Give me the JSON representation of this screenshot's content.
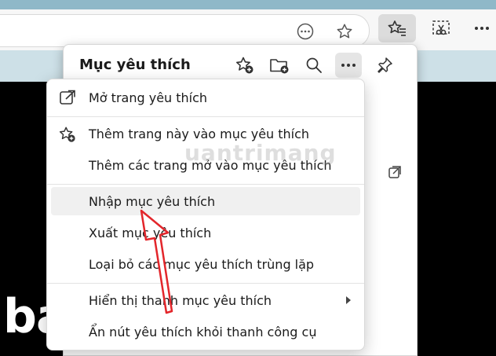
{
  "panel": {
    "title": "Mục yêu thích"
  },
  "menu": {
    "items": [
      {
        "label": "Mở trang yêu thích",
        "icon": "open-external-icon"
      },
      {
        "label": "Thêm trang này vào mục yêu thích",
        "icon": "add-favorite-icon"
      },
      {
        "label": "Thêm các trang mở vào mục yêu thích"
      },
      {
        "label": "Nhập mục yêu thích"
      },
      {
        "label": "Xuất mục yêu thích"
      },
      {
        "label": "Loại bỏ các mục yêu thích trùng lặp"
      },
      {
        "label": "Hiển thị thanh mục yêu thích",
        "icon": "chevron-right-icon"
      },
      {
        "label": "Ẩn nút yêu thích khỏi thanh công cụ"
      }
    ]
  },
  "background": {
    "partial_text": "bả"
  },
  "watermark": {
    "text": "uantrimang"
  },
  "colors": {
    "arrow": "#e3262b",
    "highlight": "#f0f0f0"
  }
}
